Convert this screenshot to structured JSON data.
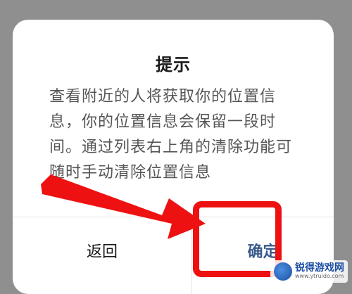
{
  "dialog": {
    "title": "提示",
    "message": "查看附近的人将获取你的位置信息，你的位置信息会保留一段时间。通过列表右上角的清除功能可随时手动清除位置信息"
  },
  "buttons": {
    "back_label": "返回",
    "ok_label": "确定"
  },
  "annotation": {
    "color": "#ee1111"
  },
  "watermark": {
    "name": "锐得游戏网",
    "url": "www.ytruido.com"
  }
}
